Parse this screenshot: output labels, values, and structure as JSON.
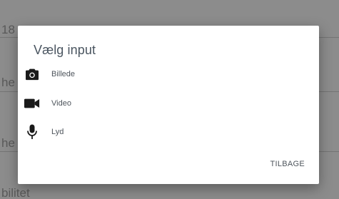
{
  "background": {
    "fields": [
      {
        "text": "18 ⁠…"
      },
      {
        "text": "he"
      },
      {
        "text": "he"
      },
      {
        "text": "bilitet"
      }
    ]
  },
  "dialog": {
    "title": "Vælg input",
    "options": [
      {
        "label": "Billede",
        "icon": "camera-icon"
      },
      {
        "label": "Video",
        "icon": "videocam-icon"
      },
      {
        "label": "Lyd",
        "icon": "microphone-icon"
      }
    ],
    "back_label": "TILBAGE"
  },
  "colors": {
    "scrim": "#6b6b6b",
    "dialog_bg": "#ffffff",
    "text": "#4e555c",
    "icon": "#1a1a1a"
  }
}
